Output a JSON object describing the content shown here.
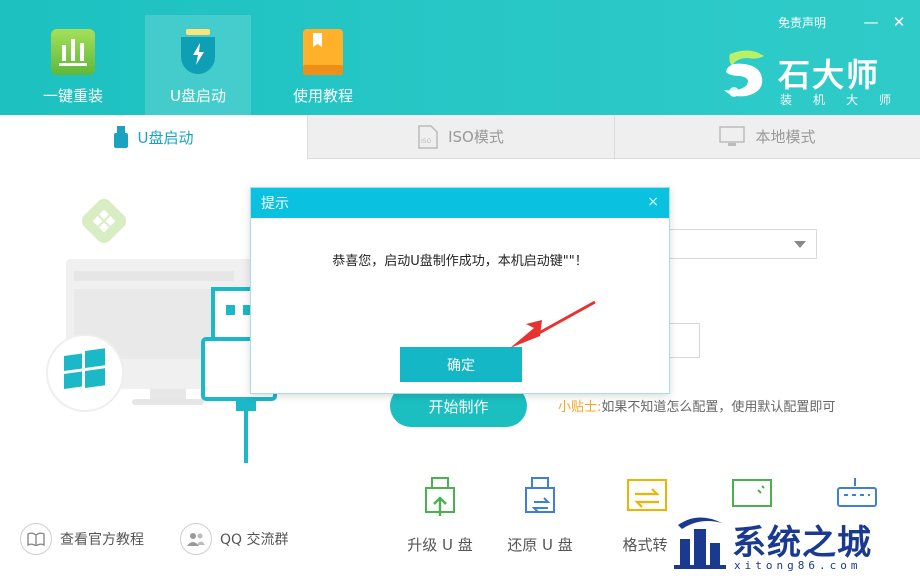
{
  "header": {
    "nav": [
      {
        "label": "一键重装",
        "icon": "bar-chart-icon"
      },
      {
        "label": "U盘启动",
        "icon": "usb-shield-icon"
      },
      {
        "label": "使用教程",
        "icon": "book-icon"
      }
    ],
    "disclaimer": "免责声明",
    "minimize": "—",
    "close": "✕",
    "brand": {
      "name": "石大师",
      "subtitle": "装机大师"
    }
  },
  "tabs": [
    {
      "label": "U盘启动",
      "icon": "usb-drive-icon"
    },
    {
      "label": "ISO模式",
      "icon": "iso-file-icon"
    },
    {
      "label": "本地模式",
      "icon": "monitor-icon"
    }
  ],
  "main": {
    "start_button": "开始制作",
    "tip_label": "小贴士:",
    "tip_text": "如果不知道怎么配置，使用默认配置即可"
  },
  "bottom_links": [
    {
      "label": "查看官方教程",
      "icon": "book-open-icon"
    },
    {
      "label": "QQ 交流群",
      "icon": "users-icon"
    }
  ],
  "tools": [
    {
      "label": "升级 U 盘",
      "icon": "usb-upgrade-icon"
    },
    {
      "label": "还原 U 盘",
      "icon": "usb-restore-icon"
    },
    {
      "label": "格式转",
      "icon": "format-convert-icon"
    }
  ],
  "modal": {
    "title": "提示",
    "close": "×",
    "message": "恭喜您，启动U盘制作成功，本机启动键\"\"！",
    "ok": "确定"
  },
  "watermark": {
    "text": "系统之城",
    "url_text": "xitong86.com"
  },
  "colors": {
    "accent": "#1bbfc0",
    "modal_header": "#0bc1e0",
    "tip": "#f5a623"
  }
}
